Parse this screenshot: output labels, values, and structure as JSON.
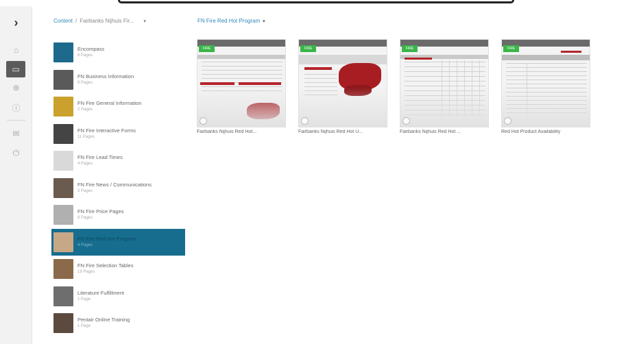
{
  "breadcrumb": {
    "root": "Content",
    "separator": "/",
    "folder": "Fairbanks Nijhuis Fir...",
    "caret": "▾",
    "current": "FN Fire Red Hot Program",
    "current_caret": "▾"
  },
  "rail": {
    "expand_icon": "›",
    "home_icon": "⌂",
    "content_icon": "▭",
    "compass_icon": "⊛",
    "info_icon": "ⓘ",
    "mail_icon": "✉",
    "power_icon": "⏻"
  },
  "folders": [
    {
      "name": "Encompass",
      "count": "6 Pages",
      "color": "#1d6a8c"
    },
    {
      "name": "FN Business Information",
      "count": "8 Pages",
      "color": "#5a5a5a"
    },
    {
      "name": "FN Fire General Information",
      "count": "2 Pages",
      "color": "#c9a12c"
    },
    {
      "name": "FN Fire Interactive Forms",
      "count": "11 Pages",
      "color": "#444444"
    },
    {
      "name": "FN Fire Lead Times",
      "count": "4 Pages",
      "color": "#d9d9d9"
    },
    {
      "name": "FN Fire News / Communications",
      "count": "3 Pages",
      "color": "#6b5a4e"
    },
    {
      "name": "FN Fire Price Pages",
      "count": "8 Pages",
      "color": "#b0b0b0"
    },
    {
      "name": "FN Fire Red Hot Program",
      "count": "4 Pages",
      "color": "#c7a886"
    },
    {
      "name": "FN Fire Selection Tables",
      "count": "19 Pages",
      "color": "#8a6a4a"
    },
    {
      "name": "Literature Fulfillment",
      "count": "1 Page",
      "color": "#6e6e6e"
    },
    {
      "name": "Pentair Online Training",
      "count": "1 Page",
      "color": "#5c4a3f"
    }
  ],
  "documents": [
    {
      "label": "Fairbanks Nijhuis Red Hot...",
      "badge": "FIRE"
    },
    {
      "label": "Fairbanks Nijhuis Red Hot U...",
      "badge": "FIRE"
    },
    {
      "label": "Fairbanks Nijhuis Red Hot ...",
      "badge": "FIRE"
    },
    {
      "label": "Red Hot Product Availability",
      "badge": "FIRE"
    }
  ],
  "colors": {
    "selected": "#176d8e",
    "link": "#2d8ab8",
    "brand_red": "#b5242a",
    "badge_green": "#3ab54a"
  }
}
